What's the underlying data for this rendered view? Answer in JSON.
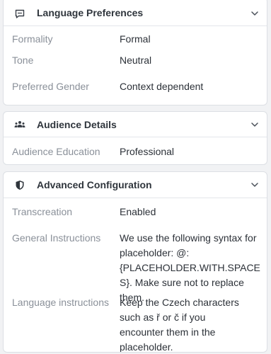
{
  "sections": {
    "language": {
      "title": "Language Preferences",
      "icon": "chat-bubble-icon",
      "rows": [
        {
          "label": "Formality",
          "value": "Formal"
        },
        {
          "label": "Tone",
          "value": "Neutral"
        },
        {
          "label": "Preferred Gender",
          "value": "Context dependent"
        }
      ]
    },
    "audience": {
      "title": "Audience Details",
      "icon": "people-icon",
      "rows": [
        {
          "label": "Audience Education",
          "value": "Professional"
        }
      ]
    },
    "advanced": {
      "title": "Advanced Configuration",
      "icon": "shield-icon",
      "rows": [
        {
          "label": "Transcreation",
          "value": "Enabled"
        },
        {
          "label": "General Instructions",
          "value": "We use the following syntax for placeholder: @:{PLACEHOLDER.WITH.SPACES}. Make sure not to replace them."
        },
        {
          "label": "Language instructions",
          "value": "Keep the Czech characters such as ř or č if you encounter them in the placeholder."
        }
      ]
    }
  }
}
